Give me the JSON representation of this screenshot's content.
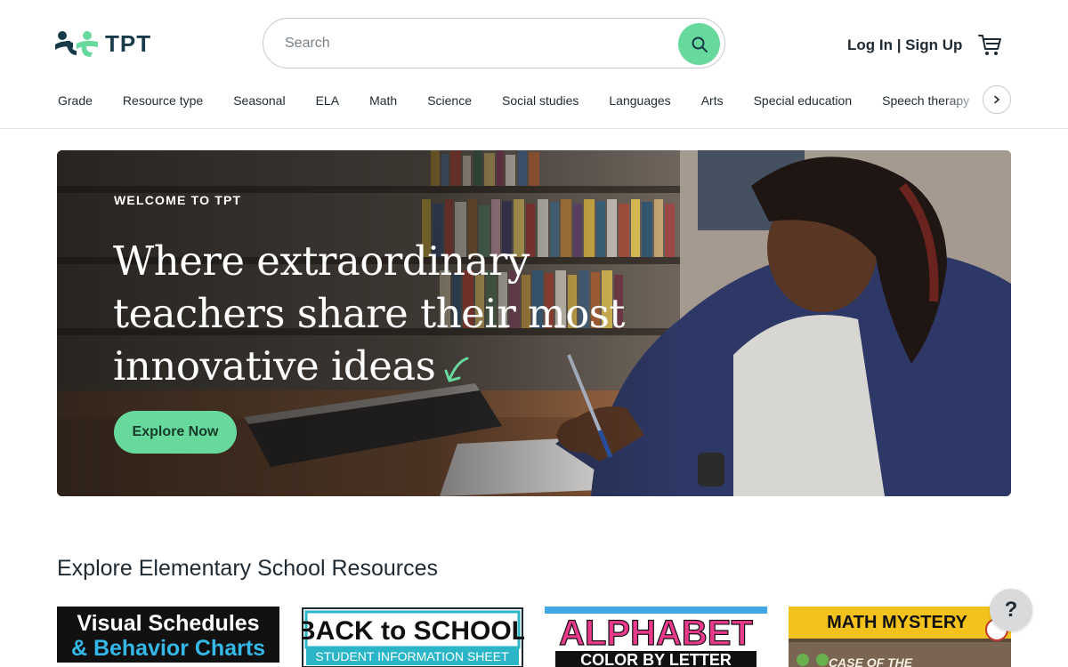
{
  "header": {
    "logo_text": "TPT",
    "search_placeholder": "Search",
    "auth_label": "Log In | Sign Up",
    "cart_icon": "cart-icon"
  },
  "nav": {
    "items": [
      "Grade",
      "Resource type",
      "Seasonal",
      "ELA",
      "Math",
      "Science",
      "Social studies",
      "Languages",
      "Arts",
      "Special education",
      "Speech therapy"
    ],
    "next_icon": "chevron-right-icon"
  },
  "hero": {
    "eyebrow": "WELCOME TO TPT",
    "title": "Where extraordinary teachers share their most innovative ideas",
    "button_label": "Explore Now"
  },
  "section": {
    "title": "Explore Elementary School Resources",
    "cards": [
      {
        "line1": "Visual Schedules",
        "line2": "& Behavior Charts"
      },
      {
        "line1": "BACK to SCHOOL",
        "line2": "STUDENT INFORMATION SHEET"
      },
      {
        "line1": "ALPHABET",
        "line2": "COLOR BY LETTER"
      },
      {
        "line1": "MATH MYSTERY",
        "line2": "CASE OF THE"
      }
    ]
  },
  "help_label": "?",
  "colors": {
    "accent_green": "#67d99c",
    "brand_navy": "#173b4a",
    "text": "#1e2a33"
  }
}
